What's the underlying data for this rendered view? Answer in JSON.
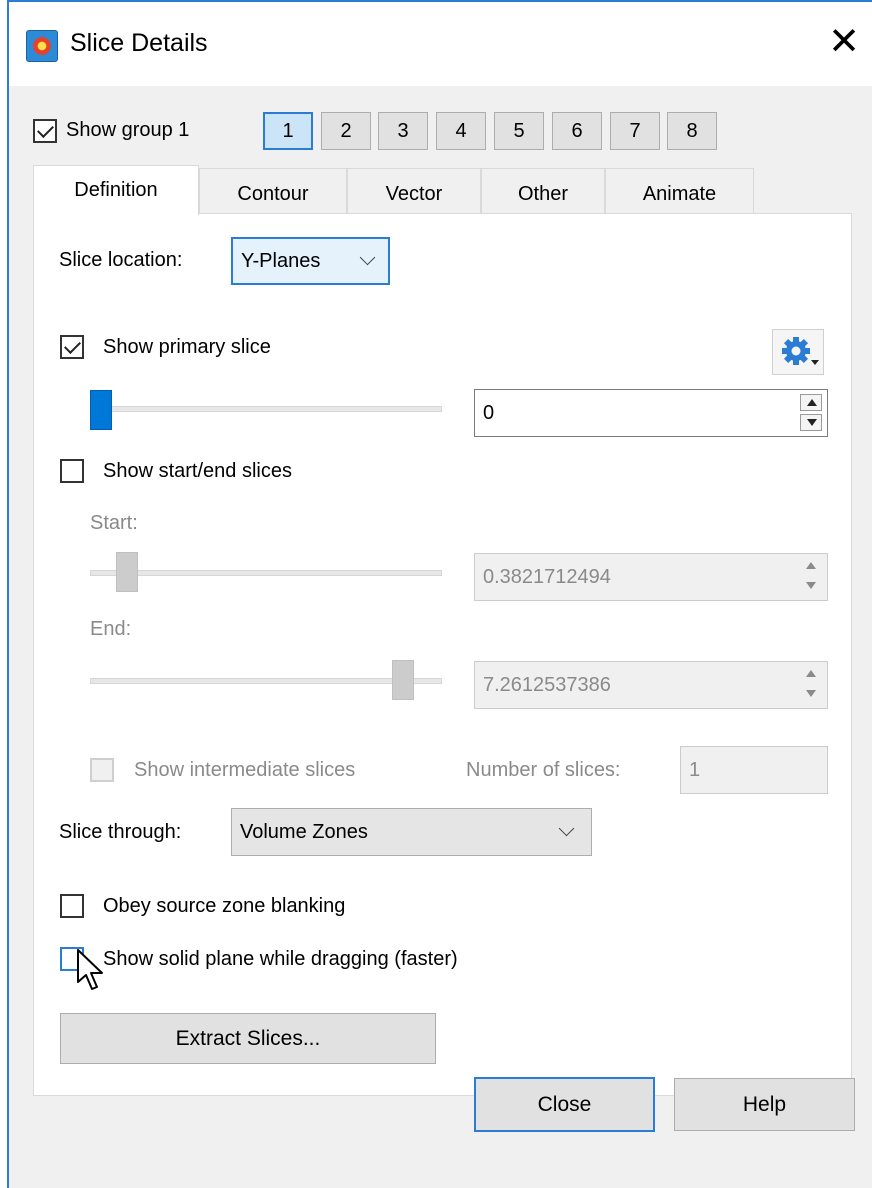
{
  "window": {
    "title": "Slice Details",
    "close_glyph": "✕",
    "icon": "app-icon"
  },
  "group": {
    "show_label": "Show group 1",
    "checked": true,
    "buttons": [
      "1",
      "2",
      "3",
      "4",
      "5",
      "6",
      "7",
      "8"
    ],
    "active": "1"
  },
  "tabs": [
    "Definition",
    "Contour",
    "Vector",
    "Other",
    "Animate"
  ],
  "active_tab": "Definition",
  "definition": {
    "slice_location_label": "Slice location:",
    "slice_location_value": "Y-Planes",
    "show_primary_label": "Show primary slice",
    "show_primary_checked": true,
    "primary_value": "0",
    "primary_slider_fraction": 0,
    "show_start_end_label": "Show start/end slices",
    "show_start_end_checked": false,
    "start_label": "Start:",
    "start_value": "0.3821712494",
    "start_slider_fraction": 0.08,
    "end_label": "End:",
    "end_value": "7.2612537386",
    "end_slider_fraction": 0.92,
    "show_intermediate_label": "Show intermediate slices",
    "number_of_slices_label": "Number of slices:",
    "number_of_slices_value": "1",
    "slice_through_label": "Slice through:",
    "slice_through_value": "Volume Zones",
    "obey_blanking_label": "Obey source zone blanking",
    "show_solid_label": "Show solid plane while dragging (faster)",
    "extract_button": "Extract Slices..."
  },
  "footer": {
    "close_button": "Close",
    "help_button": "Help"
  },
  "colors": {
    "accent": "#2b7cd3",
    "slider_thumb": "#0078d7",
    "dialog_bg": "#f0f0f0"
  }
}
